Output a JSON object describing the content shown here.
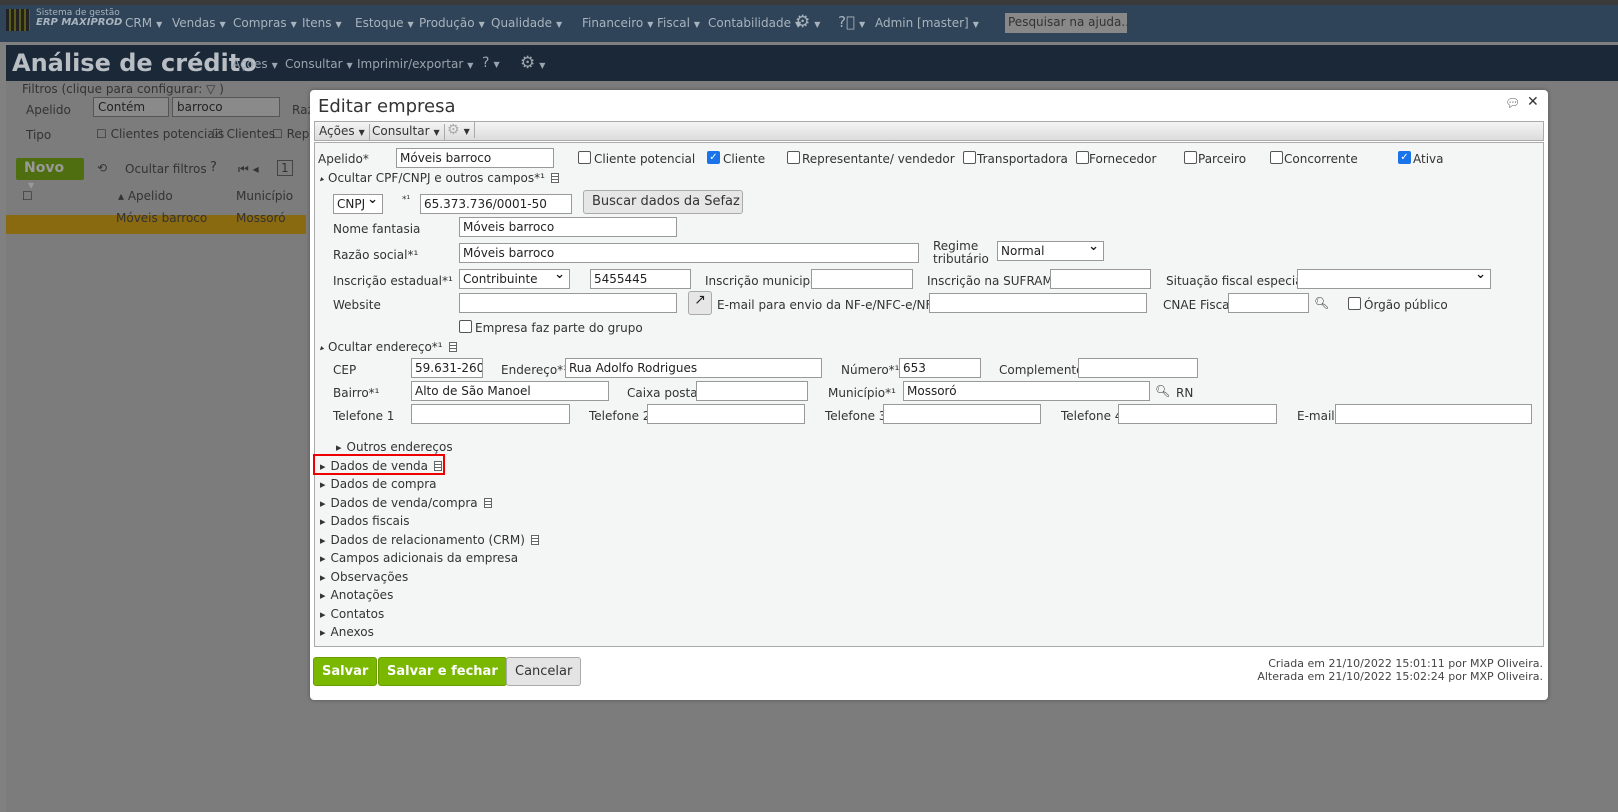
{
  "topnav": {
    "logo_line1": "Sistema de gestão",
    "logo_line2": "ERP MAXIPROD",
    "menus": [
      "CRM",
      "Vendas",
      "Compras",
      "Itens",
      "Estoque",
      "Produção",
      "Qualidade",
      "Financeiro",
      "Fiscal",
      "Contabilidade"
    ],
    "user": "Admin [master]",
    "search_placeholder": "Pesquisar na ajuda..."
  },
  "page": {
    "title": "Análise de crédito",
    "toolbar": [
      "Ações",
      "Consultar",
      "Imprimir/exportar"
    ]
  },
  "filters": {
    "legend": "Filtros (clique para configurar:",
    "apelido_label": "Apelido",
    "apelido_op": "Contém",
    "apelido_value": "barroco",
    "razao_partial": "Raz",
    "tipo_label": "Tipo",
    "tipo_options": [
      {
        "label": "Clientes potenciais",
        "checked": false
      },
      {
        "label": "Clientes",
        "checked": true
      },
      {
        "label": "Rep",
        "checked": false
      }
    ]
  },
  "list": {
    "new_button": "Novo",
    "hide_filters": "Ocultar filtros",
    "page": "1",
    "columns": [
      "Apelido",
      "Município"
    ],
    "rows": [
      {
        "apelido": "Móveis barroco",
        "municipio": "Mossoró"
      }
    ]
  },
  "dialog": {
    "title": "Editar empresa",
    "toolbar": [
      "Ações",
      "Consultar"
    ],
    "apelido_label": "Apelido*",
    "apelido": "Móveis barroco",
    "types": [
      {
        "label": "Cliente potencial",
        "checked": false
      },
      {
        "label": "Cliente",
        "checked": true
      },
      {
        "label": "Representante/ vendedor",
        "checked": false
      },
      {
        "label": "Transportadora",
        "checked": false
      },
      {
        "label": "Fornecedor",
        "checked": false
      },
      {
        "label": "Parceiro",
        "checked": false
      },
      {
        "label": "Concorrente",
        "checked": false
      },
      {
        "label": "Ativa",
        "checked": true
      }
    ],
    "section_cnpj": "Ocultar CPF/CNPJ e outros campos*¹",
    "doc_type": "CNPJ",
    "doc_req": "*¹",
    "doc_number": "65.373.736/0001-50",
    "sefaz_button": "Buscar dados da Sefaz",
    "nome_fantasia_label": "Nome fantasia",
    "nome_fantasia": "Móveis barroco",
    "razao_label": "Razão social*¹",
    "razao": "Móveis barroco",
    "regime_label": "Regime tributário",
    "regime": "Normal",
    "ie_label": "Inscrição estadual*¹",
    "ie_type": "Contribuinte",
    "ie": "5455445",
    "im_label": "Inscrição municipal",
    "im": "",
    "suframa_label": "Inscrição na SUFRAMA",
    "suframa": "",
    "sfe_label": "Situação fiscal especial",
    "sfe": "",
    "website_label": "Website",
    "website": "",
    "email_nfe_label": "E-mail para envio da NF-e/NFC-e/NFS-e",
    "email_nfe": "",
    "cnae_label": "CNAE Fiscal",
    "cnae": "",
    "orgao_label": "Órgão público",
    "orgao_checked": false,
    "grupo_label": "Empresa faz parte do grupo",
    "grupo_checked": false,
    "section_endereco": "Ocultar endereço*¹",
    "cep_label": "CEP",
    "cep": "59.631-260",
    "endereco_label": "Endereço*¹",
    "endereco": "Rua Adolfo Rodrigues",
    "numero_label": "Número*¹",
    "numero": "653",
    "complemento_label": "Complemento",
    "complemento": "",
    "bairro_label": "Bairro*¹",
    "bairro": "Alto de São Manoel",
    "caixa_label": "Caixa postal",
    "caixa": "",
    "municipio_label": "Município*¹",
    "municipio": "Mossoró",
    "uf": "RN",
    "tel1_label": "Telefone 1",
    "tel2_label": "Telefone 2",
    "tel3_label": "Telefone 3",
    "tel4_label": "Telefone 4",
    "email_label": "E-mail",
    "outros_enderecos": "Outros endereços",
    "sections": [
      "Dados de venda",
      "Dados de compra",
      "Dados de venda/compra",
      "Dados fiscais",
      "Dados de relacionamento (CRM)",
      "Campos adicionais da empresa",
      "Observações",
      "Anotações",
      "Contatos",
      "Anexos"
    ],
    "save": "Salvar",
    "save_close": "Salvar e fechar",
    "cancel": "Cancelar",
    "created": "Criada em 21/10/2022 15:01:11 por MXP Oliveira.",
    "modified": "Alterada em 21/10/2022 15:02:24 por MXP Oliveira."
  },
  "colors": {
    "accent_green": "#7ab800",
    "highlight": "#e00000",
    "checkbox": "#1a73e8"
  }
}
